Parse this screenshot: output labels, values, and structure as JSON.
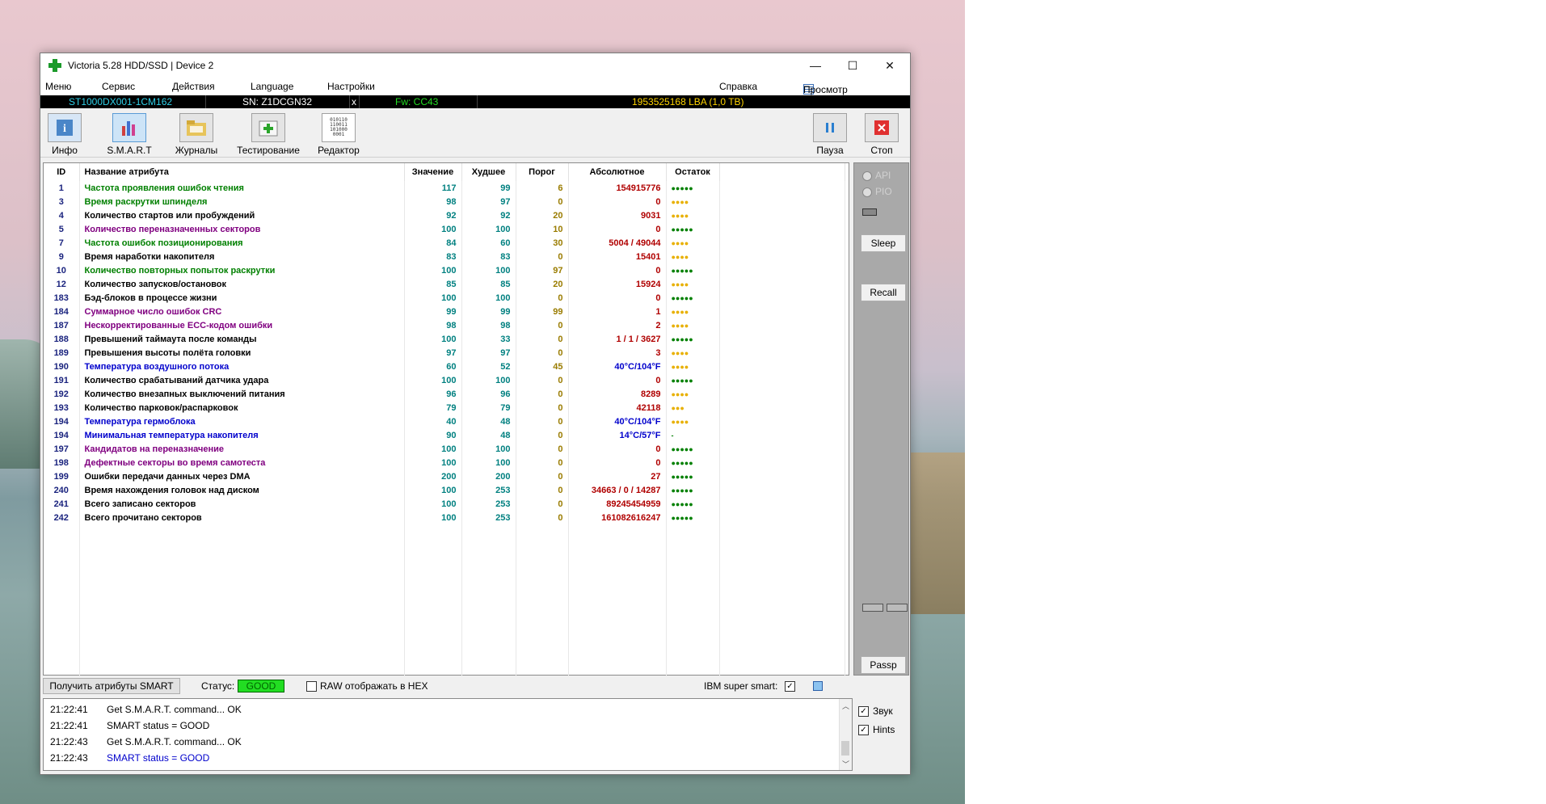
{
  "window": {
    "title": "Victoria 5.28 HDD/SSD | Device 2",
    "controls": {
      "minimize": "—",
      "maximize": "☐",
      "close": "✕"
    }
  },
  "menu": {
    "items": [
      "Меню",
      "Сервис",
      "Действия",
      "Language",
      "Настройки"
    ],
    "help": "Справка",
    "buffer": "Просмотр буфера"
  },
  "device": {
    "model": "ST1000DX001-1CM162",
    "serial": "SN: Z1DCGN32",
    "x": "x",
    "firmware": "Fw: CC43",
    "capacity": "1953525168 LBA (1,0 TB)"
  },
  "toolbar": {
    "info": "Инфо",
    "smart": "S.M.A.R.T",
    "logs": "Журналы",
    "test": "Тестирование",
    "editor": "Редактор",
    "pause": "Пауза",
    "stop": "Стоп",
    "editor_icon_text": "010110 110011 101000 0001"
  },
  "table": {
    "headers": {
      "id": "ID",
      "name": "Название атрибута",
      "value": "Значение",
      "worst": "Худшее",
      "threshold": "Порог",
      "absolute": "Абсолютное",
      "remaining": "Остаток"
    },
    "rows": [
      {
        "id": "1",
        "name": "Частота проявления ошибок чтения",
        "value": "117",
        "worst": "99",
        "thr": "6",
        "abs": "154915776",
        "rem": "●●●●●",
        "name_color": "#008000",
        "rem_color": "#008000",
        "abs_kind": "normal"
      },
      {
        "id": "3",
        "name": "Время раскрутки шпинделя",
        "value": "98",
        "worst": "97",
        "thr": "0",
        "abs": "0",
        "rem": "●●●●",
        "name_color": "#008000",
        "rem_color": "#e8b000",
        "abs_kind": "normal"
      },
      {
        "id": "4",
        "name": "Количество стартов или пробуждений",
        "value": "92",
        "worst": "92",
        "thr": "20",
        "abs": "9031",
        "rem": "●●●●",
        "name_color": "#000000",
        "rem_color": "#e8b000",
        "abs_kind": "normal"
      },
      {
        "id": "5",
        "name": "Количество переназначенных секторов",
        "value": "100",
        "worst": "100",
        "thr": "10",
        "abs": "0",
        "rem": "●●●●●",
        "name_color": "#800080",
        "rem_color": "#008000",
        "abs_kind": "normal"
      },
      {
        "id": "7",
        "name": "Частота ошибок позиционирования",
        "value": "84",
        "worst": "60",
        "thr": "30",
        "abs": "5004 / 49044",
        "rem": "●●●●",
        "name_color": "#008000",
        "rem_color": "#e8b000",
        "abs_kind": "normal"
      },
      {
        "id": "9",
        "name": "Время наработки накопителя",
        "value": "83",
        "worst": "83",
        "thr": "0",
        "abs": "15401",
        "rem": "●●●●",
        "name_color": "#000000",
        "rem_color": "#e8b000",
        "abs_kind": "normal"
      },
      {
        "id": "10",
        "name": "Количество повторных попыток раскрутки",
        "value": "100",
        "worst": "100",
        "thr": "97",
        "abs": "0",
        "rem": "●●●●●",
        "name_color": "#008000",
        "rem_color": "#008000",
        "abs_kind": "normal"
      },
      {
        "id": "12",
        "name": "Количество запусков/остановок",
        "value": "85",
        "worst": "85",
        "thr": "20",
        "abs": "15924",
        "rem": "●●●●",
        "name_color": "#000000",
        "rem_color": "#e8b000",
        "abs_kind": "normal"
      },
      {
        "id": "183",
        "name": "Бэд-блоков в процессе жизни",
        "value": "100",
        "worst": "100",
        "thr": "0",
        "abs": "0",
        "rem": "●●●●●",
        "name_color": "#000000",
        "rem_color": "#008000",
        "abs_kind": "normal"
      },
      {
        "id": "184",
        "name": "Суммарное число ошибок CRC",
        "value": "99",
        "worst": "99",
        "thr": "99",
        "abs": "1",
        "rem": "●●●●",
        "name_color": "#800080",
        "rem_color": "#e8b000",
        "abs_kind": "normal"
      },
      {
        "id": "187",
        "name": "Нескорректированные ECC-кодом ошибки",
        "value": "98",
        "worst": "98",
        "thr": "0",
        "abs": "2",
        "rem": "●●●●",
        "name_color": "#800080",
        "rem_color": "#e8b000",
        "abs_kind": "normal"
      },
      {
        "id": "188",
        "name": "Превышений таймаута после команды",
        "value": "100",
        "worst": "33",
        "thr": "0",
        "abs": "1 / 1 / 3627",
        "rem": "●●●●●",
        "name_color": "#000000",
        "rem_color": "#008000",
        "abs_kind": "normal"
      },
      {
        "id": "189",
        "name": "Превышения высоты полёта головки",
        "value": "97",
        "worst": "97",
        "thr": "0",
        "abs": "3",
        "rem": "●●●●",
        "name_color": "#000000",
        "rem_color": "#e8b000",
        "abs_kind": "normal"
      },
      {
        "id": "190",
        "name": "Температура воздушного потока",
        "value": "60",
        "worst": "52",
        "thr": "45",
        "abs": "40°C/104°F",
        "rem": "●●●●",
        "name_color": "#0000cc",
        "rem_color": "#e8b000",
        "abs_kind": "temp"
      },
      {
        "id": "191",
        "name": "Количество срабатываний датчика удара",
        "value": "100",
        "worst": "100",
        "thr": "0",
        "abs": "0",
        "rem": "●●●●●",
        "name_color": "#000000",
        "rem_color": "#008000",
        "abs_kind": "normal"
      },
      {
        "id": "192",
        "name": "Количество внезапных выключений питания",
        "value": "96",
        "worst": "96",
        "thr": "0",
        "abs": "8289",
        "rem": "●●●●",
        "name_color": "#000000",
        "rem_color": "#e8b000",
        "abs_kind": "normal"
      },
      {
        "id": "193",
        "name": "Количество парковок/распарковок",
        "value": "79",
        "worst": "79",
        "thr": "0",
        "abs": "42118",
        "rem": "●●●",
        "name_color": "#000000",
        "rem_color": "#e8b000",
        "abs_kind": "normal"
      },
      {
        "id": "194",
        "name": "Температура гермоблока",
        "value": "40",
        "worst": "48",
        "thr": "0",
        "abs": "40°C/104°F",
        "rem": "●●●●",
        "name_color": "#0000cc",
        "rem_color": "#e8b000",
        "abs_kind": "temp"
      },
      {
        "id": "194",
        "name": "Минимальная температура накопителя",
        "value": "90",
        "worst": "48",
        "thr": "0",
        "abs": "14°C/57°F",
        "rem": "-",
        "name_color": "#0000cc",
        "rem_color": "#008000",
        "abs_kind": "temp"
      },
      {
        "id": "197",
        "name": "Кандидатов на переназначение",
        "value": "100",
        "worst": "100",
        "thr": "0",
        "abs": "0",
        "rem": "●●●●●",
        "name_color": "#800080",
        "rem_color": "#008000",
        "abs_kind": "normal"
      },
      {
        "id": "198",
        "name": "Дефектные секторы во время самотеста",
        "value": "100",
        "worst": "100",
        "thr": "0",
        "abs": "0",
        "rem": "●●●●●",
        "name_color": "#800080",
        "rem_color": "#008000",
        "abs_kind": "normal"
      },
      {
        "id": "199",
        "name": "Ошибки передачи данных через DMA",
        "value": "200",
        "worst": "200",
        "thr": "0",
        "abs": "27",
        "rem": "●●●●●",
        "name_color": "#000000",
        "rem_color": "#008000",
        "abs_kind": "normal"
      },
      {
        "id": "240",
        "name": "Время нахождения головок над диском",
        "value": "100",
        "worst": "253",
        "thr": "0",
        "abs": "34663 / 0 / 14287",
        "rem": "●●●●●",
        "name_color": "#000000",
        "rem_color": "#008000",
        "abs_kind": "normal"
      },
      {
        "id": "241",
        "name": "Всего записано секторов",
        "value": "100",
        "worst": "253",
        "thr": "0",
        "abs": "89245454959",
        "rem": "●●●●●",
        "name_color": "#000000",
        "rem_color": "#008000",
        "abs_kind": "normal"
      },
      {
        "id": "242",
        "name": "Всего прочитано секторов",
        "value": "100",
        "worst": "253",
        "thr": "0",
        "abs": "161082616247",
        "rem": "●●●●●",
        "name_color": "#000000",
        "rem_color": "#008000",
        "abs_kind": "normal"
      }
    ]
  },
  "status": {
    "get_smart": "Получить атрибуты SMART",
    "label": "Статус:",
    "value": "GOOD",
    "raw_hex": "RAW отображать в HEX",
    "raw_hex_checked": false,
    "ibm": "IBM super smart:",
    "ibm_checked": true
  },
  "log": [
    {
      "time": "21:22:41",
      "msg": "Get S.M.A.R.T. command... OK",
      "color": "#000000"
    },
    {
      "time": "21:22:41",
      "msg": "SMART status = GOOD",
      "color": "#000000"
    },
    {
      "time": "21:22:43",
      "msg": "Get S.M.A.R.T. command... OK",
      "color": "#000000"
    },
    {
      "time": "21:22:43",
      "msg": "SMART status = GOOD",
      "color": "#0000cc"
    }
  ],
  "sidebar": {
    "api": "API",
    "pio": "PIO",
    "sleep": "Sleep",
    "recall": "Recall",
    "passp": "Passp",
    "sound": "Звук",
    "hints": "Hints",
    "sound_checked": true,
    "hints_checked": true
  },
  "colors": {
    "good_bg": "#22dd22",
    "value_teal": "#008080",
    "abs_red": "#b00000",
    "id_navy": "#1a237e"
  }
}
